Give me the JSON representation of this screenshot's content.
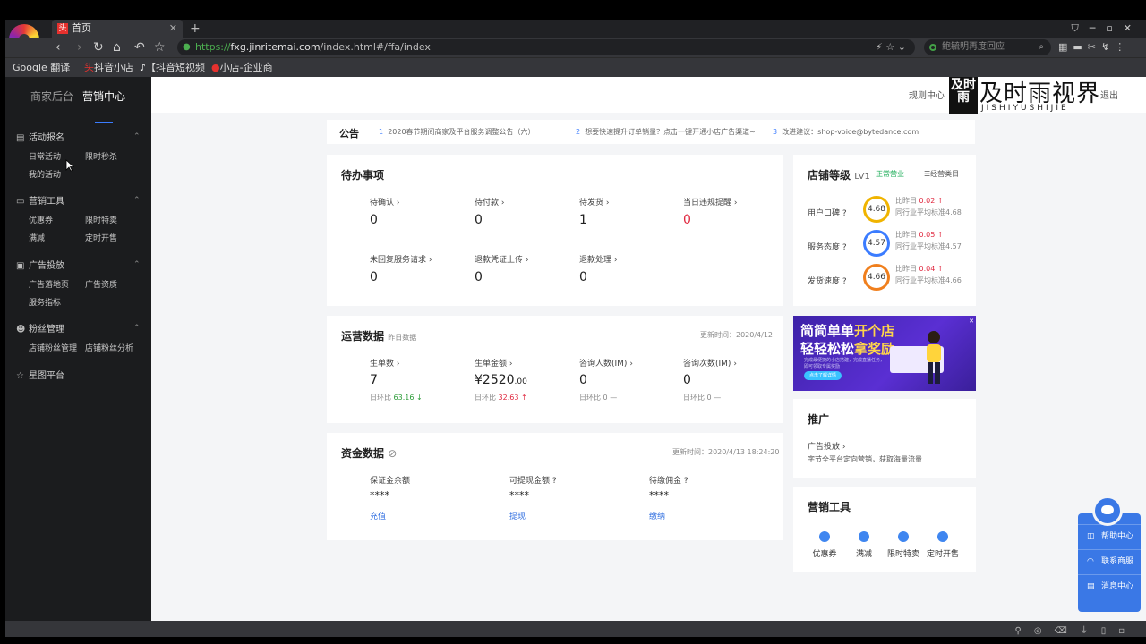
{
  "browser": {
    "tab_title": "首页",
    "tab_favicon": "头",
    "url_prefix": "https://",
    "url_host": "fxg.jinritemai.com",
    "url_path": "/index.html#/ffa/index",
    "search_placeholder": "鲍毓明再度回应",
    "bookmarks": [
      "Google 翻译",
      "抖音小店",
      "【抖音短视频",
      "小店-企业商"
    ]
  },
  "sidebar": {
    "tabs": [
      "商家后台",
      "营销中心"
    ],
    "groups": [
      {
        "title": "活动报名",
        "icon": "calendar-icon",
        "items": [
          "日常活动",
          "限时秒杀",
          "我的活动"
        ]
      },
      {
        "title": "营销工具",
        "icon": "toolbox-icon",
        "items": [
          "优惠券",
          "限时特卖",
          "满减",
          "定时开售"
        ]
      },
      {
        "title": "广告投放",
        "icon": "ad-icon",
        "items": [
          "广告落地页",
          "广告资质",
          "服务指标"
        ]
      },
      {
        "title": "粉丝管理",
        "icon": "fans-icon",
        "items": [
          "店铺粉丝管理",
          "店铺粉丝分析"
        ]
      },
      {
        "title": "星图平台",
        "icon": "star-icon",
        "items": []
      }
    ]
  },
  "header": {
    "rules_link": "规则中心",
    "logout": "退出"
  },
  "watermark": {
    "square": "及时雨",
    "title": "及时雨视界",
    "subtitle": "JISHIYUSHIJIE"
  },
  "notice": {
    "title": "公告",
    "items": [
      {
        "num": "1",
        "text": "2020春节期间商家及平台服务调整公告（六）"
      },
      {
        "num": "2",
        "text": "想要快速提升订单销量？点击一键开通小店广告渠道~"
      },
      {
        "num": "3",
        "text": "改进建议：shop-voice@bytedance.com"
      }
    ]
  },
  "todo": {
    "title": "待办事项",
    "items": [
      {
        "label": "待确认",
        "value": "0",
        "alert": false
      },
      {
        "label": "待付款",
        "value": "0",
        "alert": false
      },
      {
        "label": "待发货",
        "value": "1",
        "alert": false
      },
      {
        "label": "当日违规提醒",
        "value": "0",
        "alert": true
      },
      {
        "label": "未回复服务请求",
        "value": "0",
        "alert": false
      },
      {
        "label": "退款凭证上传",
        "value": "0",
        "alert": false
      },
      {
        "label": "退款处理",
        "value": "0",
        "alert": false
      }
    ]
  },
  "ops": {
    "title": "运营数据",
    "subtitle": "昨日数据",
    "updated": "更新时间：2020/4/12",
    "metrics": [
      {
        "label": "生单数",
        "value": "7",
        "compare_label": "日环比",
        "compare": "63.16",
        "trend": "down"
      },
      {
        "label": "生单金额",
        "value": "¥2520",
        "decimals": ".00",
        "compare_label": "日环比",
        "compare": "32.63",
        "trend": "up"
      },
      {
        "label": "咨询人数(IM)",
        "value": "0",
        "compare_label": "日环比",
        "compare": "0",
        "trend": "flat"
      },
      {
        "label": "咨询次数(IM)",
        "value": "0",
        "compare_label": "日环比",
        "compare": "0",
        "trend": "flat"
      }
    ]
  },
  "funds": {
    "title": "资金数据",
    "updated": "更新时间：2020/4/13 18:24:20",
    "items": [
      {
        "label": "保证金余额",
        "value": "****",
        "action": "充值"
      },
      {
        "label": "可提现金额",
        "value": "****",
        "action": "提现"
      },
      {
        "label": "待缴佣金",
        "value": "****",
        "action": "缴纳"
      }
    ]
  },
  "level": {
    "title": "店铺等级",
    "level": "LV1",
    "status": "正常营业",
    "category_link": "经营类目",
    "ratings": [
      {
        "label": "用户口碑",
        "score": "4.68",
        "color": "#f0b400",
        "diff_label": "比昨日",
        "diff": "0.02",
        "industry": "同行业平均标准4.68"
      },
      {
        "label": "服务态度",
        "score": "4.57",
        "color": "#3b7cff",
        "diff_label": "比昨日",
        "diff": "0.05",
        "industry": "同行业平均标准4.57"
      },
      {
        "label": "发货速度",
        "score": "4.66",
        "color": "#f07f1d",
        "diff_label": "比昨日",
        "diff": "0.04",
        "industry": "同行业平均标准4.66"
      }
    ]
  },
  "banner": {
    "line1_a": "简简单单",
    "line1_b": "开个店",
    "line2_a": "轻轻松松",
    "line2_b": "拿奖励",
    "desc": "完成最便捷的小店搭建，完成直播任务，即可领取专属奖励",
    "button": "点击了解详情"
  },
  "promo": {
    "title": "推广",
    "link": "广告投放",
    "desc": "字节全平台定向营销，获取海量流量"
  },
  "tools": {
    "title": "营销工具",
    "items": [
      {
        "label": "优惠券",
        "color": "#3f86f0"
      },
      {
        "label": "满减",
        "color": "#3f86f0"
      },
      {
        "label": "限时特卖",
        "color": "#3f86f0"
      },
      {
        "label": "定时开售",
        "color": "#3f86f0"
      }
    ]
  },
  "floating": {
    "items": [
      "帮助中心",
      "联系商服",
      "消息中心"
    ]
  }
}
